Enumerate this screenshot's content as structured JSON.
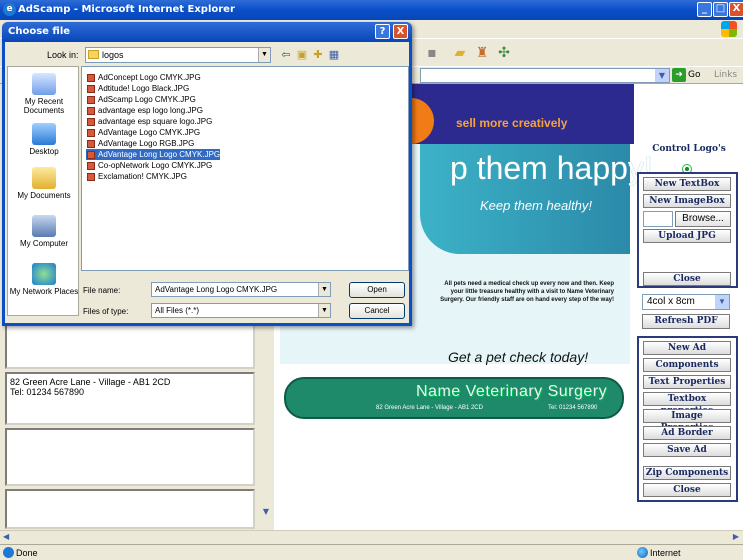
{
  "window": {
    "title": "AdScamp - Microsoft Internet Explorer",
    "min": "_",
    "max": "□",
    "close": "X"
  },
  "address": {
    "go_label": "Go",
    "links_label": "Links"
  },
  "page": {
    "banner_slogan": "sell more creatively",
    "ad": {
      "headline": "p them happy!",
      "subheadline": "Keep them healthy!",
      "body": "All pets need a medical check up every now and then. Keep your little treasure healthy with a visit to Name Veterinary Surgery. Our friendly staff are on hand every step of the way!",
      "cta": "Get a pet check today!",
      "business_name": "Name Veterinary Surgery",
      "address_line": "82 Green Acre Lane - Village - AB1 2CD",
      "tel_line": "Tel: 01234 567890"
    },
    "left_textbox": {
      "line1": "82 Green Acre Lane - Village - AB1 2CD",
      "line2": "Tel: 01234 567890"
    }
  },
  "control_panel": {
    "title": "Control Logo's",
    "new_textbox": "New TextBox",
    "new_imagebox": "New ImageBox",
    "browse": "Browse...",
    "upload_jpg": "Upload JPG",
    "close": "Close",
    "size_select": "4col x 8cm",
    "refresh_pdf": "Refresh PDF",
    "menu": [
      "New Ad",
      "Components",
      "Text Properties",
      "Textbox properties",
      "Image Properties",
      "Ad Border",
      "Save Ad",
      "Zip Components",
      "Close"
    ]
  },
  "status": {
    "left": "Done",
    "zone": "Internet"
  },
  "dialog": {
    "title": "Choose file",
    "help": "?",
    "close": "X",
    "look_in_label": "Look in:",
    "look_in_value": "logos",
    "places": [
      "My Recent Documents",
      "Desktop",
      "My Documents",
      "My Computer",
      "My Network Places"
    ],
    "files": [
      "AdConcept Logo CMYK.JPG",
      "Adtitude! Logo Black.JPG",
      "AdScamp Logo CMYK.JPG",
      "advantage esp logo long.JPG",
      "advantage esp square logo.JPG",
      "AdVantage Logo CMYK.JPG",
      "AdVantage Logo RGB.JPG",
      "AdVantage Long Logo CMYK.JPG",
      "Co-opNetwork Logo CMYK.JPG",
      "Exclamation! CMYK.JPG"
    ],
    "selected_index": 7,
    "file_name_label": "File name:",
    "file_name_value": "AdVantage Long Logo CMYK.JPG",
    "file_type_label": "Files of type:",
    "file_type_value": "All Files (*.*)",
    "open": "Open",
    "cancel": "Cancel"
  },
  "colors": {
    "title_blue": "#0a4fc8",
    "banner_navy": "#2d2a8f",
    "banner_orange": "#f07b17",
    "ad_teal": "#3cb2c7",
    "ad_green": "#1f8a6a",
    "selection": "#316ac5"
  }
}
